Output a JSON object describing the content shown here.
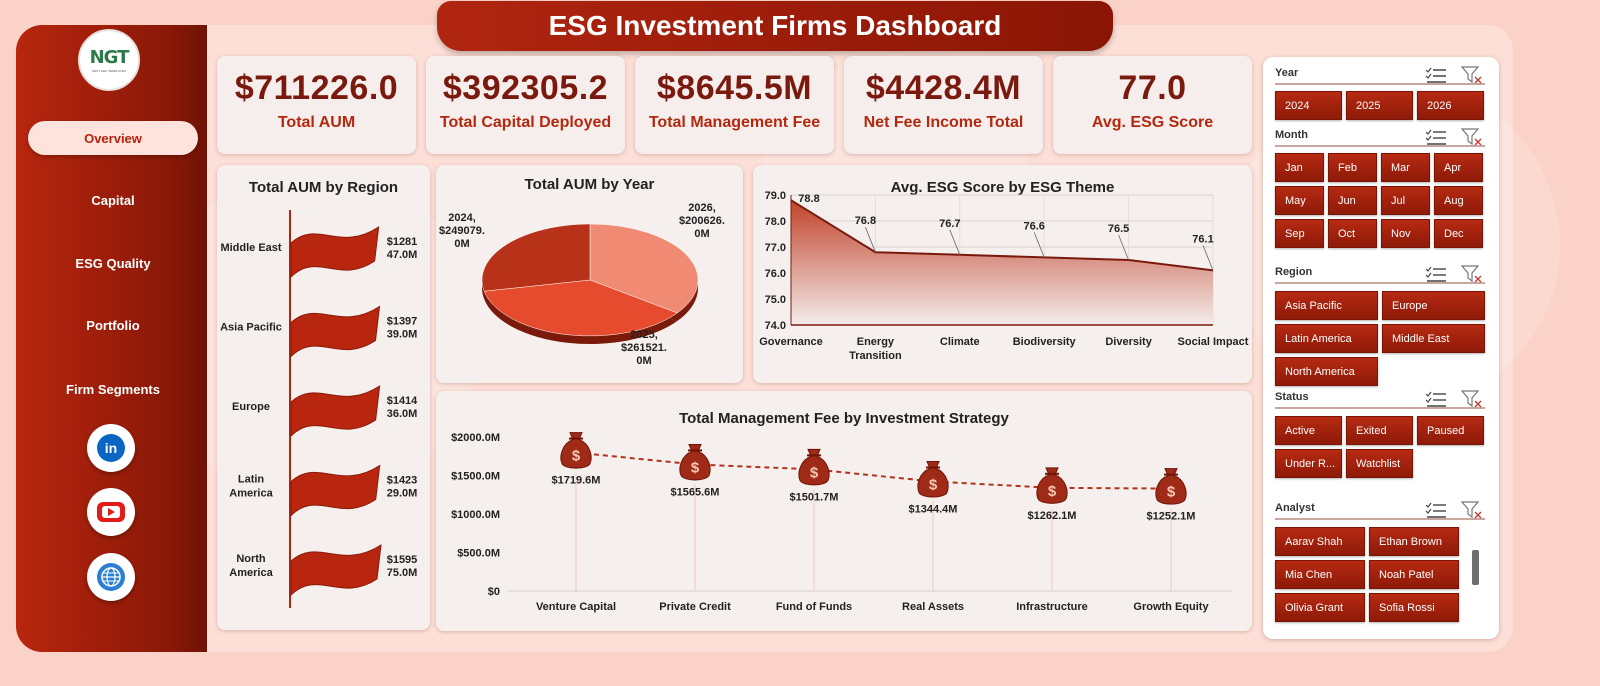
{
  "title": "ESG Investment Firms Dashboard",
  "logo": {
    "text": "NGT",
    "subtext": "NEXT GEN TEMPLATES"
  },
  "nav": [
    {
      "label": "Overview",
      "active": true
    },
    {
      "label": "Capital"
    },
    {
      "label": "ESG Quality"
    },
    {
      "label": "Portfolio"
    },
    {
      "label": "Firm Segments"
    }
  ],
  "social": [
    {
      "icon": "linkedin-icon",
      "text": "in"
    },
    {
      "icon": "youtube-icon"
    },
    {
      "icon": "globe-icon"
    }
  ],
  "kpis": [
    {
      "value": "$711226.0",
      "label": "Total AUM"
    },
    {
      "value": "$392305.2",
      "label": "Total Capital Deployed"
    },
    {
      "value": "$8645.5M",
      "label": "Total Management Fee"
    },
    {
      "value": "$4428.4M",
      "label": "Net Fee Income Total"
    },
    {
      "value": "77.0",
      "label": "Avg. ESG Score"
    }
  ],
  "chart_data": [
    {
      "type": "bar",
      "title": "Total AUM by Region",
      "categories": [
        "Middle East",
        "Asia Pacific",
        "Europe",
        "Latin America",
        "North America"
      ],
      "values": [
        128147.0,
        139739.0,
        141436.0,
        142329.0,
        159575.0
      ],
      "data_labels": [
        "$128147.0M",
        "$139739.0M",
        "$141436.0M",
        "$142329.0M",
        "$159575.0M"
      ]
    },
    {
      "type": "pie",
      "title": "Total AUM by Year",
      "categories": [
        "2024",
        "2025",
        "2026"
      ],
      "values": [
        249079.0,
        261521.0,
        200626.0
      ],
      "data_labels": [
        "2024, $249079.0M",
        "2025, $261521.0M",
        "2026, $200626.0M"
      ],
      "colors": [
        "#f08a72",
        "#e54b2c",
        "#b8321a"
      ]
    },
    {
      "type": "area",
      "title": "Avg. ESG Score by ESG Theme",
      "categories": [
        "Governance",
        "Energy Transition",
        "Climate",
        "Biodiversity",
        "Diversity",
        "Social Impact"
      ],
      "values": [
        78.8,
        76.8,
        76.7,
        76.6,
        76.5,
        76.1
      ],
      "y_ticks": [
        "74.0",
        "75.0",
        "76.0",
        "77.0",
        "78.0",
        "79.0"
      ],
      "ylim": [
        74.0,
        79.0
      ],
      "grid": true
    },
    {
      "type": "line",
      "title": "Total Management Fee by Investment Strategy",
      "categories": [
        "Venture Capital",
        "Private Credit",
        "Fund of Funds",
        "Real Assets",
        "Infrastructure",
        "Growth Equity"
      ],
      "values": [
        1719.6,
        1565.6,
        1501.7,
        1344.4,
        1262.1,
        1252.1
      ],
      "data_labels": [
        "$1719.6M",
        "$1565.6M",
        "$1501.7M",
        "$1344.4M",
        "$1262.1M",
        "$1252.1M"
      ],
      "y_ticks": [
        "$0",
        "$500.0M",
        "$1000.0M",
        "$1500.0M",
        "$2000.0M"
      ],
      "ylim": [
        0,
        2000
      ],
      "marker": "money-bag-icon"
    }
  ],
  "slicers": {
    "year": {
      "title": "Year",
      "items": [
        "2024",
        "2025",
        "2026"
      ]
    },
    "month": {
      "title": "Month",
      "items": [
        "Jan",
        "Feb",
        "Mar",
        "Apr",
        "May",
        "Jun",
        "Jul",
        "Aug",
        "Sep",
        "Oct",
        "Nov",
        "Dec"
      ]
    },
    "region": {
      "title": "Region",
      "items": [
        "Asia Pacific",
        "Europe",
        "Latin America",
        "Middle East",
        "North America"
      ]
    },
    "status": {
      "title": "Status",
      "items": [
        "Active",
        "Exited",
        "Paused",
        "Under R...",
        "Watchlist"
      ]
    },
    "analyst": {
      "title": "Analyst",
      "items": [
        "Aarav Shah",
        "Ethan Brown",
        "Mia Chen",
        "Noah Patel",
        "Olivia Grant",
        "Sofia Rossi"
      ]
    }
  },
  "colors": {
    "primary": "#b3240e",
    "dark": "#7a1a0e",
    "background": "#fbd2c8"
  }
}
